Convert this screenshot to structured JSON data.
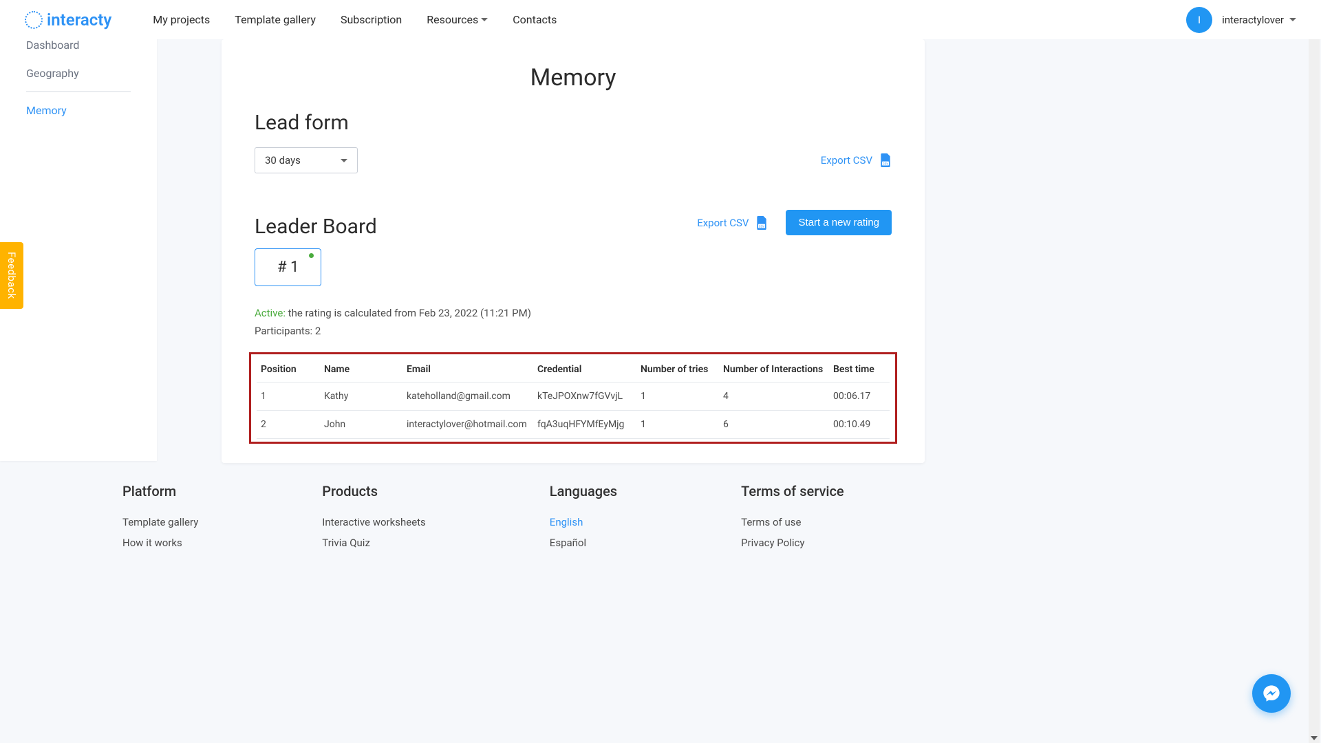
{
  "brand": "interacty",
  "nav": {
    "my_projects": "My projects",
    "template_gallery": "Template gallery",
    "subscription": "Subscription",
    "resources": "Resources",
    "contacts": "Contacts"
  },
  "user": {
    "initial": "I",
    "name": "interactylover"
  },
  "sidebar": {
    "dashboard": "Dashboard",
    "geography": "Geography",
    "memory": "Memory"
  },
  "page": {
    "title": "Memory",
    "lead_form_title": "Lead form",
    "period_selected": "30 days",
    "export_csv": "Export CSV",
    "leader_board_title": "Leader Board",
    "start_new_rating": "Start a new rating",
    "rating_badge": "# 1",
    "status_active": "Active:",
    "status_text": " the rating is calculated from Feb 23, 2022 (11:21 PM)",
    "participants_label": "Participants: ",
    "participants_count": "2"
  },
  "table": {
    "headers": {
      "position": "Position",
      "name": "Name",
      "email": "Email",
      "credential": "Credential",
      "tries": "Number of tries",
      "interactions": "Number of Interactions",
      "best_time": "Best time"
    },
    "rows": [
      {
        "position": "1",
        "name": "Kathy",
        "email": "kateholland@gmail.com",
        "credential": "kTeJPOXnw7fGVvjL",
        "tries": "1",
        "interactions": "4",
        "best_time": "00:06.17"
      },
      {
        "position": "2",
        "name": "John",
        "email": "interactylover@hotmail.com",
        "credential": "fqA3uqHFYMfEyMjg",
        "tries": "1",
        "interactions": "6",
        "best_time": "00:10.49"
      }
    ]
  },
  "feedback_label": "Feedback",
  "footer": {
    "platform": {
      "title": "Platform",
      "template_gallery": "Template gallery",
      "how_it_works": "How it works"
    },
    "products": {
      "title": "Products",
      "interactive_worksheets": "Interactive worksheets",
      "trivia_quiz": "Trivia Quiz"
    },
    "languages": {
      "title": "Languages",
      "english": "English",
      "espanol": "Español"
    },
    "terms": {
      "title": "Terms of service",
      "terms_of_use": "Terms of use",
      "privacy_policy": "Privacy Policy"
    }
  }
}
